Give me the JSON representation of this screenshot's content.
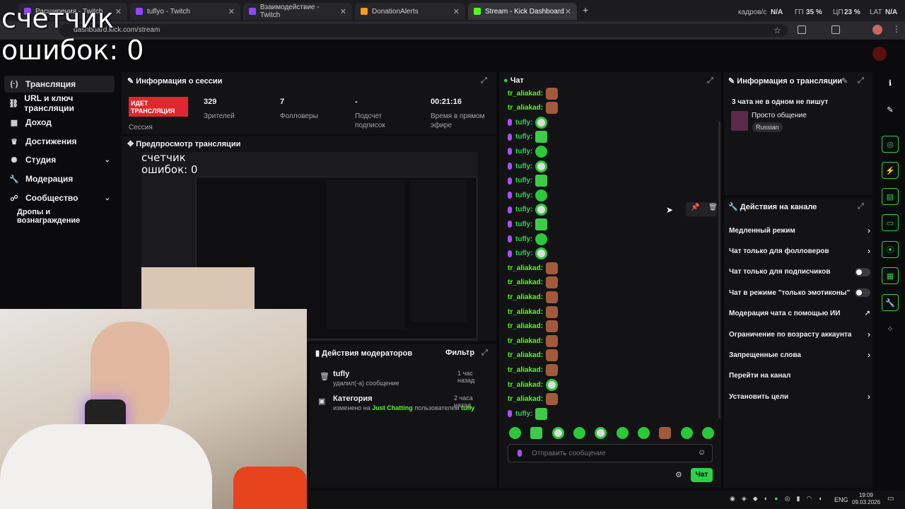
{
  "browser": {
    "tabs": [
      "Расширения - Twitch",
      "tuflyo - Twitch",
      "Взаимодействие - Twitch",
      "DonationAlerts",
      "Stream - Kick Dashboard"
    ],
    "url": "dashboard.kick.com/stream",
    "stats": {
      "fps_label": "кадров/с",
      "fps": "N/A",
      "gpu_label": "ГП",
      "gpu": "35 %",
      "cpu_label": "ЦП",
      "cpu": "23 %",
      "lat_label": "LAT",
      "lat": "N/A"
    }
  },
  "overlay": {
    "line1": "счетчик",
    "line2": "ошибок: 0"
  },
  "sidebar": {
    "items": [
      {
        "label": "Трансляция",
        "icon": "broadcast-icon"
      },
      {
        "label": "URL и ключ трансляции",
        "icon": "link-icon"
      },
      {
        "label": "Доход",
        "icon": "revenue-icon"
      },
      {
        "label": "Достижения",
        "icon": "trophy-icon"
      },
      {
        "label": "Студия",
        "icon": "studio-icon"
      },
      {
        "label": "Модерация",
        "icon": "wrench-icon"
      },
      {
        "label": "Сообщество",
        "icon": "community-icon"
      },
      {
        "label": "Дропы и вознаграждение",
        "icon": ""
      }
    ]
  },
  "session": {
    "title": "Информация о сессии",
    "live_badge": "ИДЕТ ТРАНСЛЯЦИЯ",
    "live_label": "Сессия",
    "stats": [
      {
        "value": "329",
        "label": "Зрителей"
      },
      {
        "value": "7",
        "label": "Фолловеры"
      },
      {
        "value": "-",
        "label": "Подсчет подписок"
      },
      {
        "value": "00:21:16",
        "label": "Время в прямом эфире"
      }
    ]
  },
  "preview": {
    "title": "Предпросмотр трансляции",
    "overlay1": "счетчик",
    "overlay2": "ошибок: 0"
  },
  "mod_actions": {
    "title": "Действия модераторов",
    "filter": "Фильтр",
    "items": [
      {
        "user": "tufly",
        "desc": "удалил(-а) сообщение",
        "time": "1 час назад"
      },
      {
        "user": "Категория",
        "desc_pre": "изменено на",
        "category": "Just Chatting",
        "desc_mid": "пользователем",
        "by": "tufly",
        "time": "2 часа назад"
      }
    ]
  },
  "chat": {
    "title": "Чат",
    "messages": [
      {
        "user": "tr_aliakad:",
        "emote": "e1",
        "mic": false
      },
      {
        "user": "tr_aliakad:",
        "emote": "e1",
        "mic": false
      },
      {
        "user": "tufly:",
        "emote": "e3",
        "mic": true
      },
      {
        "user": "tufly:",
        "emote": "e4",
        "mic": true
      },
      {
        "user": "tufly:",
        "emote": "e2",
        "mic": true
      },
      {
        "user": "tufly:",
        "emote": "e3",
        "mic": true
      },
      {
        "user": "tufly:",
        "emote": "e4",
        "mic": true
      },
      {
        "user": "tufly:",
        "emote": "e2",
        "mic": true
      },
      {
        "user": "tufly:",
        "emote": "e3",
        "mic": true
      },
      {
        "user": "tufly:",
        "emote": "e4",
        "mic": true
      },
      {
        "user": "tufly:",
        "emote": "e2",
        "mic": true
      },
      {
        "user": "tufly:",
        "emote": "e3",
        "mic": true
      },
      {
        "user": "tr_aliakad:",
        "emote": "e1",
        "mic": false
      },
      {
        "user": "tr_aliakad:",
        "emote": "e1",
        "mic": false
      },
      {
        "user": "tr_aliakad:",
        "emote": "e1",
        "mic": false
      },
      {
        "user": "tr_aliakad:",
        "emote": "e1",
        "mic": false
      },
      {
        "user": "tr_aliakad:",
        "emote": "e1",
        "mic": false
      },
      {
        "user": "tr_aliakad:",
        "emote": "e1",
        "mic": false
      },
      {
        "user": "tr_aliakad:",
        "emote": "e1",
        "mic": false
      },
      {
        "user": "tr_aliakad:",
        "emote": "e1",
        "mic": false
      },
      {
        "user": "tr_aliakad:",
        "emote": "e3",
        "mic": false
      },
      {
        "user": "tr_aliakad:",
        "emote": "e1",
        "mic": false
      },
      {
        "user": "tufly:",
        "emote": "e4",
        "mic": true
      }
    ],
    "input_placeholder": "Отправить сообщение",
    "send_label": "Чат"
  },
  "stream_info": {
    "title": "Информация о трансляции",
    "note": "3 чата не в одном не пишут",
    "stream_title": "Просто общение",
    "language": "Russian"
  },
  "channel_actions": {
    "title": "Действия на канале",
    "items": [
      {
        "label": "Медленный режим",
        "control": "arrow"
      },
      {
        "label": "Чат только для фолловеров",
        "control": "arrow"
      },
      {
        "label": "Чат только для подписчиков",
        "control": "toggle"
      },
      {
        "label": "Чат в режиме \"только эмотиконы\"",
        "control": "toggle"
      },
      {
        "label": "Модерация чата с помощью ИИ",
        "control": "external"
      },
      {
        "label": "Ограничение по возрасту аккаунта",
        "control": "arrow"
      },
      {
        "label": "Запрещенные слова",
        "control": "arrow"
      },
      {
        "label": "Перейти на канал",
        "control": "none"
      },
      {
        "label": "Установить цели",
        "control": "arrow"
      }
    ]
  },
  "taskbar": {
    "lang": "ENG",
    "time": "19:09",
    "date": "09.03.2026"
  },
  "colors": {
    "kick_green": "#53fc18",
    "live_red": "#e0262e",
    "mic_purple": "#a850ff",
    "accent_green": "#2bd24a"
  }
}
